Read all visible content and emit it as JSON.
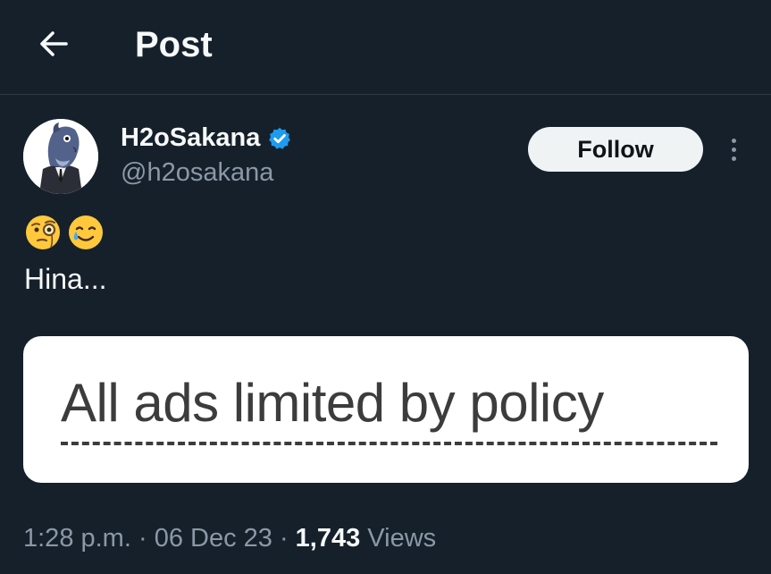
{
  "header": {
    "title": "Post",
    "back_icon": "arrow-left-icon"
  },
  "author": {
    "display_name": "H2oSakana",
    "handle": "@h2osakana",
    "verified_icon": "verified-badge-icon",
    "verified_color": "#1d9bf0"
  },
  "actions": {
    "follow_label": "Follow",
    "more_icon": "more-vertical-icon"
  },
  "post": {
    "emojis": [
      "face-with-monocle-emoji",
      "smiling-face-with-tear-emoji"
    ],
    "text": "Hina..."
  },
  "media": {
    "text": "All ads limited by policy"
  },
  "meta": {
    "time": "1:28 p.m.",
    "sep1": " · ",
    "date": "06 Dec 23",
    "sep2": " · ",
    "views_count": "1,743",
    "views_label": " Views"
  },
  "colors": {
    "background": "#15202b",
    "primary_text": "#f7f9f9",
    "secondary_text": "#8b98a5",
    "accent": "#1d9bf0"
  }
}
